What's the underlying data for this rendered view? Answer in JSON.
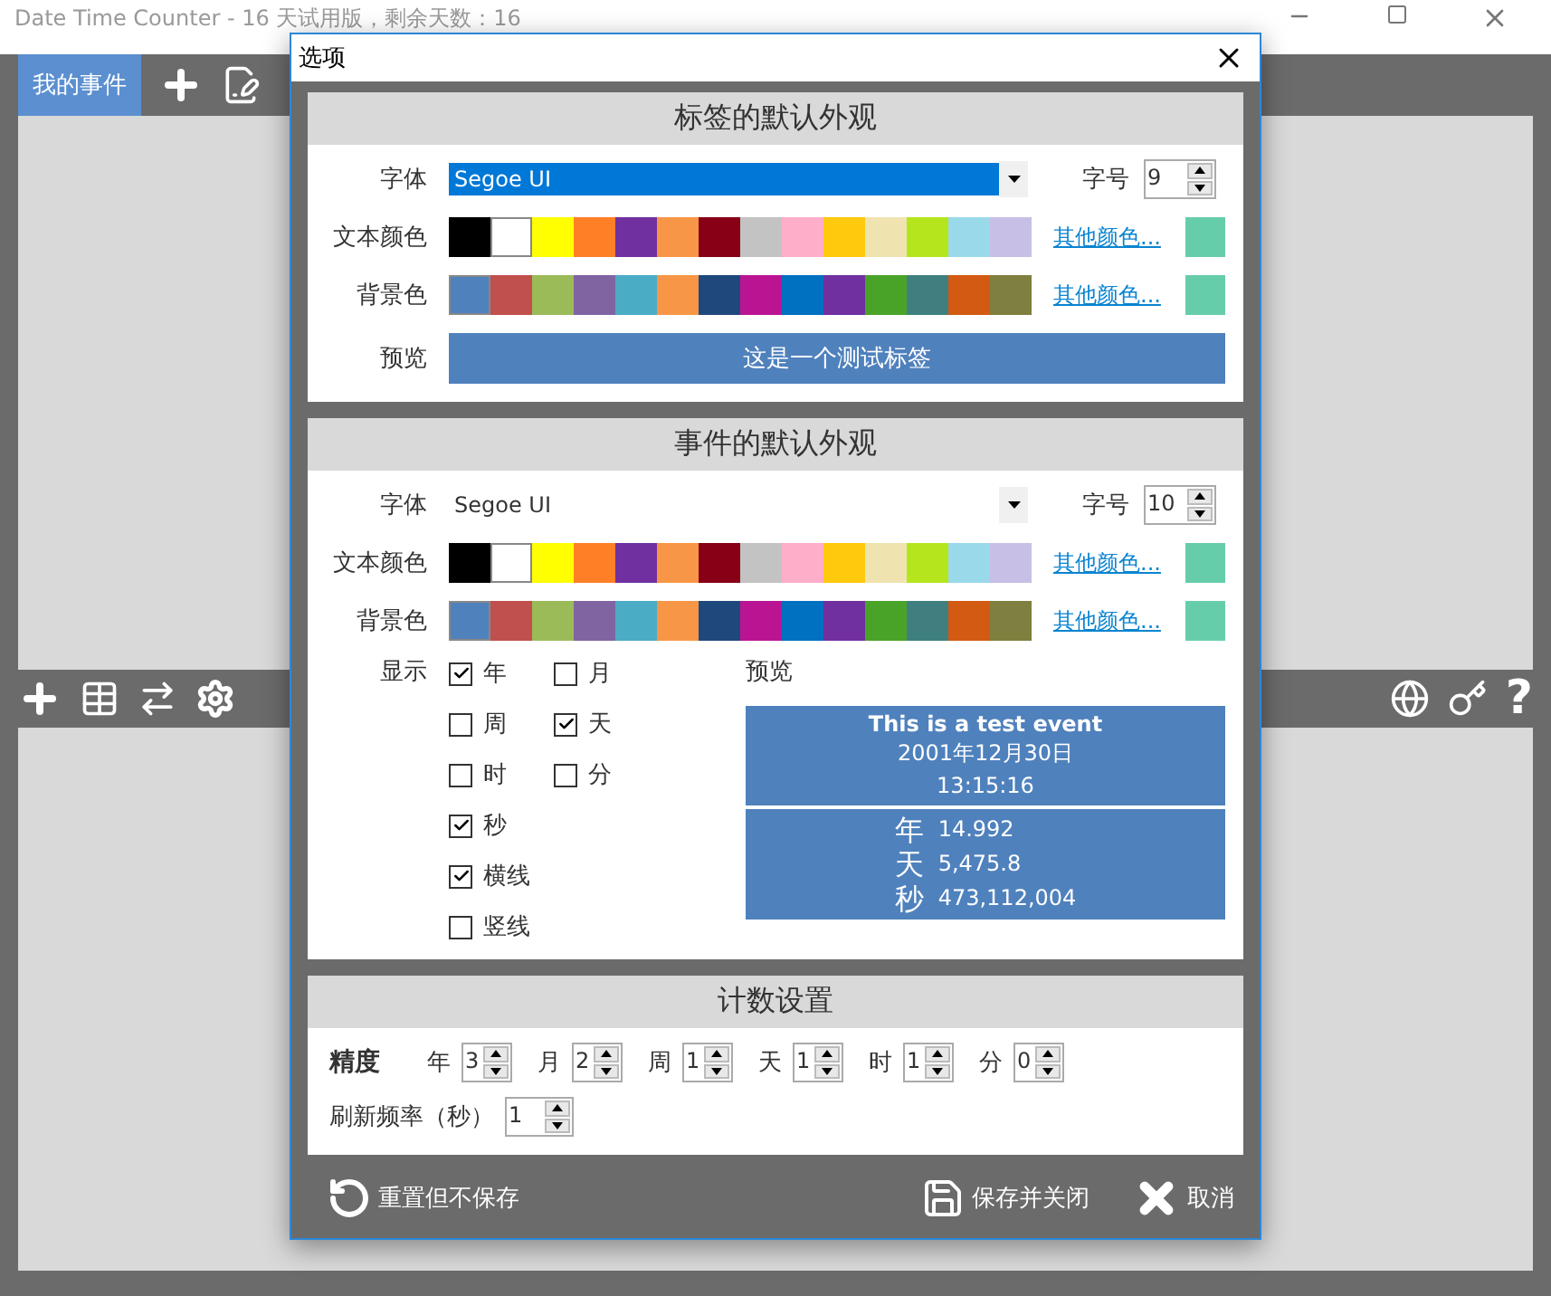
{
  "app": {
    "title": "Date Time Counter - 16 天试用版，剩余天数：16",
    "toolbar": {
      "tab": "我的事件",
      "tab_selected": true
    },
    "help_glyph": "?"
  },
  "dialog": {
    "title": "选项",
    "sections": [
      {
        "kind": "appearance",
        "title": "标签的默认外观",
        "font_label": "字体",
        "font": "Segoe UI",
        "font_highlighted": true,
        "size_label": "字号",
        "size": "9",
        "color_rows": [
          {
            "label": "文本颜色",
            "more": "其他颜色...",
            "colors": [
              {
                "color": "#000000",
                "selected": false
              },
              {
                "color": "#ffffff",
                "selected": true
              },
              {
                "color": "#ffff00",
                "selected": false
              },
              {
                "color": "#ff7f27",
                "selected": false
              },
              {
                "color": "#7030a0",
                "selected": false
              },
              {
                "color": "#f79646",
                "selected": false
              },
              {
                "color": "#880015",
                "selected": false
              },
              {
                "color": "#c3c3c3",
                "selected": false
              },
              {
                "color": "#ffaec9",
                "selected": false
              },
              {
                "color": "#ffc90e",
                "selected": false
              },
              {
                "color": "#efe4b0",
                "selected": false
              },
              {
                "color": "#b5e61d",
                "selected": false
              },
              {
                "color": "#99d9ea",
                "selected": false
              },
              {
                "color": "#c8bfe7",
                "selected": false
              }
            ],
            "custom": {
              "color": "#66cdaa"
            }
          },
          {
            "label": "背景色",
            "more": "其他颜色...",
            "colors": [
              {
                "color": "#4f81bd",
                "selected": true
              },
              {
                "color": "#c0504d",
                "selected": false
              },
              {
                "color": "#9bbb59",
                "selected": false
              },
              {
                "color": "#8064a2",
                "selected": false
              },
              {
                "color": "#4bacc6",
                "selected": false
              },
              {
                "color": "#f79646",
                "selected": false
              },
              {
                "color": "#1f497d",
                "selected": false
              },
              {
                "color": "#bb1493",
                "selected": false
              },
              {
                "color": "#0070c0",
                "selected": false
              },
              {
                "color": "#7030a0",
                "selected": false
              },
              {
                "color": "#4aa329",
                "selected": false
              },
              {
                "color": "#3f7f7f",
                "selected": false
              },
              {
                "color": "#d35a12",
                "selected": false
              },
              {
                "color": "#7f7f3f",
                "selected": false
              }
            ],
            "custom": {
              "color": "#66cdaa"
            }
          }
        ],
        "preview_label": "预览",
        "preview_text": "这是一个测试标签"
      },
      {
        "kind": "event",
        "title": "事件的默认外观",
        "font_label": "字体",
        "font": "Segoe UI",
        "font_highlighted": false,
        "size_label": "字号",
        "size": "10",
        "color_rows": [
          {
            "label": "文本颜色",
            "more": "其他颜色...",
            "colors": [
              {
                "color": "#000000",
                "selected": false
              },
              {
                "color": "#ffffff",
                "selected": true
              },
              {
                "color": "#ffff00",
                "selected": false
              },
              {
                "color": "#ff7f27",
                "selected": false
              },
              {
                "color": "#7030a0",
                "selected": false
              },
              {
                "color": "#f79646",
                "selected": false
              },
              {
                "color": "#880015",
                "selected": false
              },
              {
                "color": "#c3c3c3",
                "selected": false
              },
              {
                "color": "#ffaec9",
                "selected": false
              },
              {
                "color": "#ffc90e",
                "selected": false
              },
              {
                "color": "#efe4b0",
                "selected": false
              },
              {
                "color": "#b5e61d",
                "selected": false
              },
              {
                "color": "#99d9ea",
                "selected": false
              },
              {
                "color": "#c8bfe7",
                "selected": false
              }
            ],
            "custom": {
              "color": "#66cdaa"
            }
          },
          {
            "label": "背景色",
            "more": "其他颜色...",
            "colors": [
              {
                "color": "#4f81bd",
                "selected": true
              },
              {
                "color": "#c0504d",
                "selected": false
              },
              {
                "color": "#9bbb59",
                "selected": false
              },
              {
                "color": "#8064a2",
                "selected": false
              },
              {
                "color": "#4bacc6",
                "selected": false
              },
              {
                "color": "#f79646",
                "selected": false
              },
              {
                "color": "#1f497d",
                "selected": false
              },
              {
                "color": "#bb1493",
                "selected": false
              },
              {
                "color": "#0070c0",
                "selected": false
              },
              {
                "color": "#7030a0",
                "selected": false
              },
              {
                "color": "#4aa329",
                "selected": false
              },
              {
                "color": "#3f7f7f",
                "selected": false
              },
              {
                "color": "#d35a12",
                "selected": false
              },
              {
                "color": "#7f7f3f",
                "selected": false
              }
            ],
            "custom": {
              "color": "#66cdaa"
            }
          }
        ],
        "show_label": "显示",
        "show_rows": [
          [
            {
              "label": "年",
              "checked": true
            },
            {
              "label": "月",
              "checked": false
            }
          ],
          [
            {
              "label": "周",
              "checked": false
            },
            {
              "label": "天",
              "checked": true
            }
          ],
          [
            {
              "label": "时",
              "checked": false
            },
            {
              "label": "分",
              "checked": false
            }
          ],
          [
            {
              "label": "秒",
              "checked": true
            }
          ],
          [
            {
              "label": "横线",
              "checked": true
            }
          ],
          [
            {
              "label": "竖线",
              "checked": false
            }
          ]
        ],
        "preview_label": "预览",
        "preview": {
          "title": "This is a test event",
          "date": "2001年12月30日",
          "time": "13:15:16",
          "rows": [
            {
              "unit": "年",
              "value": "14.992"
            },
            {
              "unit": "天",
              "value": "5,475.8"
            },
            {
              "unit": "秒",
              "value": "473,112,004"
            }
          ]
        }
      },
      {
        "kind": "counting",
        "title": "计数设置",
        "precision_label": "精度",
        "precision": [
          {
            "unit": "年",
            "value": "3"
          },
          {
            "unit": "月",
            "value": "2"
          },
          {
            "unit": "周",
            "value": "1"
          },
          {
            "unit": "天",
            "value": "1"
          },
          {
            "unit": "时",
            "value": "1"
          },
          {
            "unit": "分",
            "value": "0"
          }
        ],
        "refresh_label": "刷新频率（秒）",
        "refresh": "1"
      }
    ],
    "buttons": [
      {
        "kind": "reset",
        "label": "重置但不保存"
      },
      {
        "kind": "save",
        "label": "保存并关闭"
      },
      {
        "kind": "cancel",
        "label": "取消"
      }
    ]
  }
}
